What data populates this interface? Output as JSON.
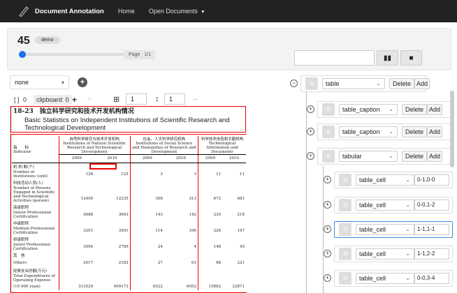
{
  "nav": {
    "brand": "Document Annotation",
    "home": "Home",
    "open_documents": "Open Documents"
  },
  "doc_panel": {
    "doc_id": "45",
    "badge": "demo",
    "page_label": "Page",
    "page_value": "1/1"
  },
  "toolbar": {
    "none_select": "none",
    "clipboard": "clipboard: 0",
    "row_input": "1",
    "col_input": "1"
  },
  "document": {
    "header": "18-23　独立科学研究和技术开发机构情况",
    "subtitle": "Basic Statistics on Independent Institutions of Scientific Research and Technological Development",
    "col_group_1": "自然科学研究与技术开发机构",
    "col_group_1_en": "Institutions of Natural Scientific Research and Technological Development",
    "col_group_2": "社会、人文科学研究机构",
    "col_group_2_en": "Institutions of Social Science and Humanities of Research and Development",
    "col_group_3": "科学技术信息和文献机构",
    "col_group_3_en": "Technological Information and Documents",
    "row_header": "指　　标",
    "row_header_en": "Indicator",
    "years": [
      "2009",
      "2010",
      "2009",
      "2010",
      "2009",
      "2010"
    ],
    "rows": [
      {
        "label": "机 构 数(个)",
        "values": []
      },
      {
        "label": "Number of Institutions (unit)",
        "values": [
          "126",
          "125",
          "3",
          "3",
          "11",
          "11"
        ]
      },
      {
        "label": "科技活动人员(人)",
        "values": []
      },
      {
        "label": "Number of Persons Engaged in Scientific",
        "values": []
      },
      {
        "label": "and Technological Activities (person)",
        "values": [
          "12400",
          "12235",
          "308",
          "313",
          "672",
          "681"
        ]
      },
      {
        "label": "高级职称",
        "values": []
      },
      {
        "label": "Senior Professional Certification",
        "values": [
          "4088",
          "3693",
          "143",
          "142",
          "230",
          "218"
        ]
      },
      {
        "label": "中级职称",
        "values": []
      },
      {
        "label": "Medium Professional Certification",
        "values": [
          "3201",
          "3591",
          "114",
          "106",
          "226",
          "197"
        ]
      },
      {
        "label": "初级职称",
        "values": []
      },
      {
        "label": "Junior Professional Certification",
        "values": [
          "3094",
          "2769",
          "24",
          "4",
          "148",
          "45"
        ]
      },
      {
        "label": "其　他",
        "values": []
      },
      {
        "label": "Others",
        "values": [
          "2017",
          "2182",
          "27",
          "61",
          "68",
          "221"
        ]
      },
      {
        "label": "经费支出总额(万元)",
        "values": []
      },
      {
        "label": "Total Expenditures of Operating Expense",
        "values": []
      },
      {
        "label": "(10 000 yuan)",
        "values": [
          "313529",
          "409173",
          "6522",
          "6052",
          "15862",
          "22871"
        ]
      }
    ]
  },
  "tree": {
    "delete_label": "Delete",
    "add_label": "Add",
    "nodes": [
      {
        "type": "table"
      },
      {
        "type": "table_caption"
      },
      {
        "type": "table_caption"
      },
      {
        "type": "tabular"
      },
      {
        "type": "table_cell",
        "ref": "0-1,0-0"
      },
      {
        "type": "table_cell",
        "ref": "0-0,1-2"
      },
      {
        "type": "table_cell",
        "ref": "1-1,1-1"
      },
      {
        "type": "table_cell",
        "ref": "1-1,2-2"
      },
      {
        "type": "table_cell",
        "ref": "0-0,3-4"
      }
    ]
  }
}
